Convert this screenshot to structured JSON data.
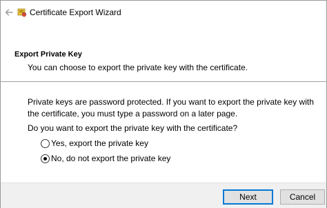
{
  "window": {
    "title": "Certificate Export Wizard"
  },
  "header": {
    "title": "Export Private Key",
    "subtitle": "You can choose to export the private key with the certificate."
  },
  "body": {
    "description": "Private keys are password protected. If you want to export the private key with the certificate, you must type a password on a later page.",
    "question": "Do you want to export the private key with the certificate?"
  },
  "options": [
    {
      "label": "Yes, export the private key",
      "selected": false
    },
    {
      "label": "No, do not export the private key",
      "selected": true
    }
  ],
  "footer": {
    "next_label": "Next",
    "cancel_label": "Cancel"
  },
  "colors": {
    "accent": "#0078d7",
    "footer_bg": "#f0f0f0",
    "button_bg": "#e1e1e1"
  },
  "icons": {
    "back": "back-arrow-icon",
    "wizard": "certificate-wizard-icon"
  }
}
